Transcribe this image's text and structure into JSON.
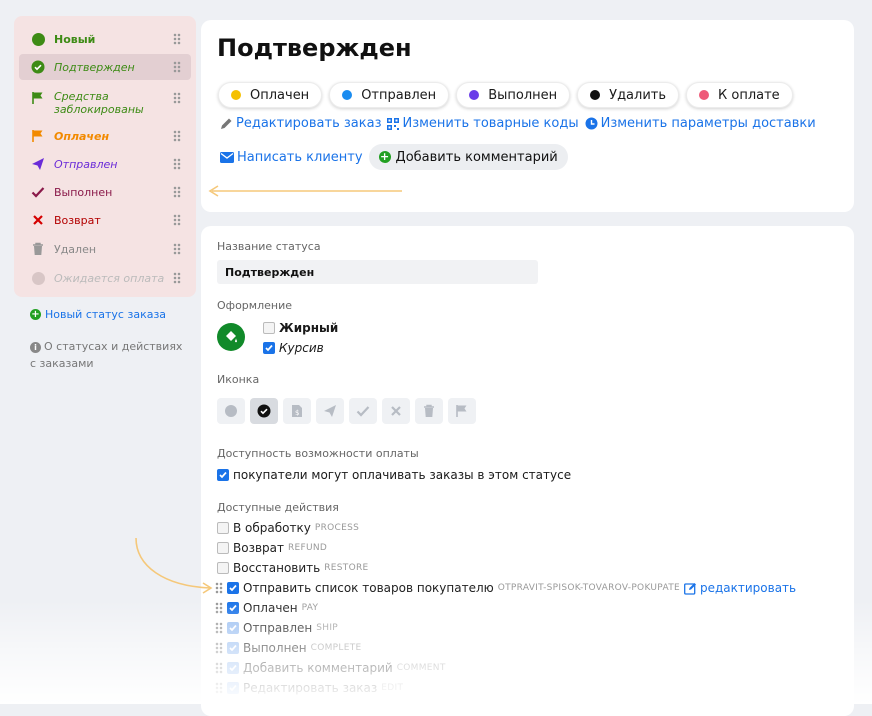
{
  "sidebar": {
    "items": [
      {
        "label": "Новый",
        "color": "#3d8b15",
        "style": "bold",
        "icon": "circle-icon"
      },
      {
        "label": "Подтвержден",
        "color": "#3d8b15",
        "style": "italic",
        "icon": "check-circle-icon"
      },
      {
        "label": "Средства заблокированы",
        "color": "#3d8b15",
        "style": "italic",
        "icon": "flag-icon"
      },
      {
        "label": "Оплачен",
        "color": "#f28a00",
        "style": "bold-italic",
        "icon": "flag-icon"
      },
      {
        "label": "Отправлен",
        "color": "#6a2bd8",
        "style": "italic",
        "icon": "paper-plane-icon"
      },
      {
        "label": "Выполнен",
        "color": "#8a1a4a",
        "style": "normal",
        "icon": "check-icon"
      },
      {
        "label": "Возврат",
        "color": "#b30000",
        "style": "normal",
        "icon": "cross-icon"
      },
      {
        "label": "Удален",
        "color": "#888888",
        "style": "normal",
        "icon": "trash-icon"
      },
      {
        "label": "Ожидается оплата",
        "color": "#bbbbbb",
        "style": "italic",
        "icon": "circle-icon"
      }
    ],
    "new_status_label": "Новый статус заказа",
    "about_label": "О статусах и действиях с заказами"
  },
  "header": {
    "title": "Подтвержден",
    "actions": [
      {
        "label": "Оплачен",
        "color": "#f5c000"
      },
      {
        "label": "Отправлен",
        "color": "#1a8cf0"
      },
      {
        "label": "Выполнен",
        "color": "#6a3de8"
      },
      {
        "label": "Удалить",
        "color": "#111111"
      },
      {
        "label": "К оплате",
        "color": "#ee5a78"
      }
    ],
    "links": {
      "edit_order": "Редактировать заказ",
      "change_codes": "Изменить товарные коды",
      "change_delivery": "Изменить параметры доставки",
      "write_client": "Написать клиенту",
      "add_comment": "Добавить комментарий"
    }
  },
  "form": {
    "status_name_label": "Название статуса",
    "status_name_value": "Подтвержден",
    "design_label": "Оформление",
    "bold_label": "Жирный",
    "bold_checked": false,
    "italic_label": "Курсив",
    "italic_checked": true,
    "icon_label": "Иконка",
    "icons": [
      "circle-icon",
      "check-circle-icon",
      "document-icon",
      "paper-plane-icon",
      "check-icon",
      "cross-icon",
      "trash-icon",
      "flag-icon"
    ],
    "selected_icon": "check-circle-icon",
    "payment_label": "Доступность возможности оплаты",
    "payment_checkbox_label": "покупатели могут оплачивать заказы в этом статусе",
    "payment_checked": true,
    "actions_label": "Доступные действия",
    "actions": [
      {
        "label": "В обработку",
        "code": "PROCESS",
        "checked": false
      },
      {
        "label": "Возврат",
        "code": "REFUND",
        "checked": false
      },
      {
        "label": "Восстановить",
        "code": "RESTORE",
        "checked": false
      },
      {
        "label": "Отправить список товаров покупателю",
        "code": "OTPRAVIT-SPISOK-TOVAROV-POKUPATE",
        "checked": true,
        "edit": "редактировать"
      },
      {
        "label": "Оплачен",
        "code": "PAY",
        "checked": true
      },
      {
        "label": "Отправлен",
        "code": "SHIP",
        "checked": true
      },
      {
        "label": "Выполнен",
        "code": "COMPLETE",
        "checked": true
      },
      {
        "label": "Добавить комментарий",
        "code": "COMMENT",
        "checked": true
      },
      {
        "label": "Редактировать заказ",
        "code": "EDIT",
        "checked": true
      }
    ]
  },
  "colors": {
    "accent": "#1a73e8",
    "selected_color": "#118a2a",
    "arrow": "#f5c87a"
  }
}
